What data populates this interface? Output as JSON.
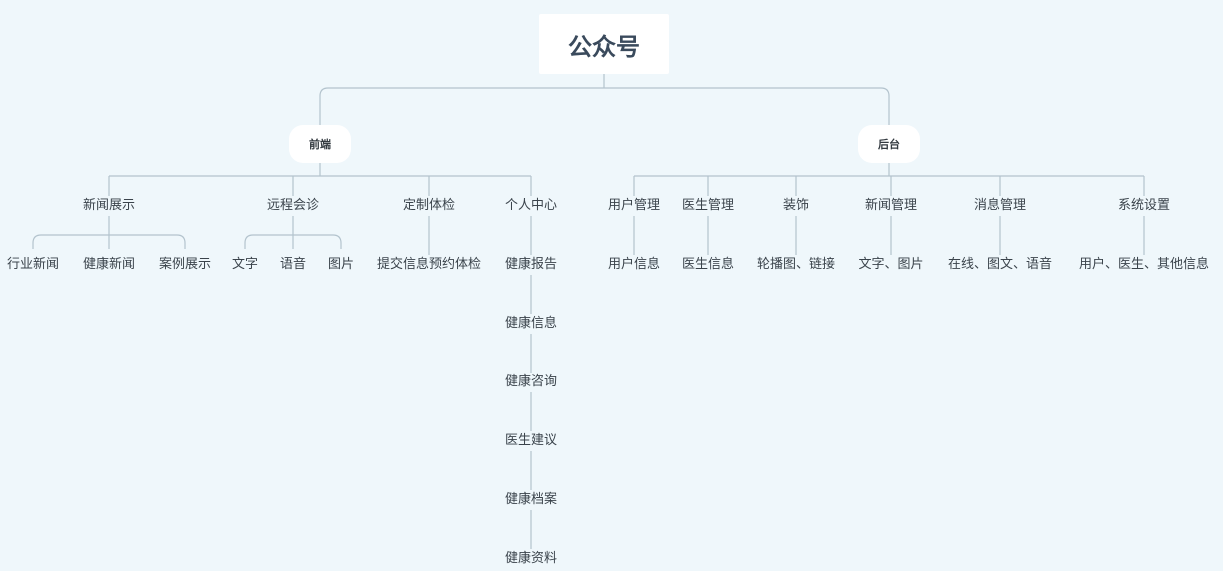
{
  "root": {
    "label": "公众号"
  },
  "branches": [
    {
      "label": "前端",
      "groups": [
        {
          "label": "新闻展示",
          "items": [
            "行业新闻",
            "健康新闻",
            "案例展示"
          ]
        },
        {
          "label": "远程会诊",
          "items": [
            "文字",
            "语音",
            "图片"
          ]
        },
        {
          "label": "定制体检",
          "items": [
            "提交信息预约体检"
          ]
        },
        {
          "label": "个人中心",
          "items": [
            "健康报告",
            "健康信息",
            "健康咨询",
            "医生建议",
            "健康档案",
            "健康资料"
          ]
        }
      ]
    },
    {
      "label": "后台",
      "groups": [
        {
          "label": "用户管理",
          "items": [
            "用户信息"
          ]
        },
        {
          "label": "医生管理",
          "items": [
            "医生信息"
          ]
        },
        {
          "label": "装饰",
          "items": [
            "轮播图、链接"
          ]
        },
        {
          "label": "新闻管理",
          "items": [
            "文字、图片"
          ]
        },
        {
          "label": "消息管理",
          "items": [
            "在线、图文、语音"
          ]
        },
        {
          "label": "系统设置",
          "items": [
            "用户、医生、其他信息"
          ]
        }
      ]
    }
  ],
  "colors": {
    "background": "#eff7fb",
    "line": "#b3c3cd",
    "node_fill": "#ffffff",
    "text": "#3a434b"
  }
}
